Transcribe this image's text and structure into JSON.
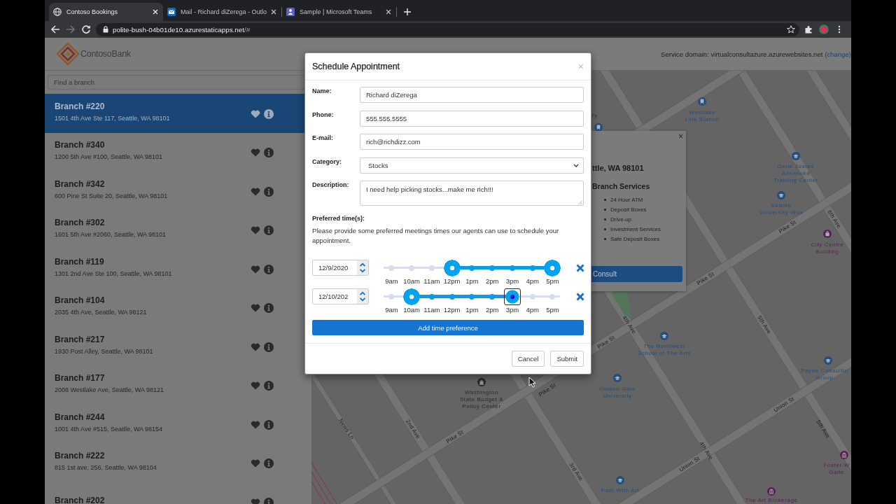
{
  "browser": {
    "tabs": [
      {
        "kind": "globe",
        "title": "Contoso Bookings",
        "selected": true
      },
      {
        "kind": "mail",
        "title": "Mail - Richard diZerega - Outlo",
        "selected": false
      },
      {
        "kind": "teams",
        "title": "Sample | Microsoft Teams",
        "selected": false
      }
    ],
    "nav": [
      {
        "kind": "back",
        "disabled": false
      },
      {
        "kind": "forward",
        "disabled": true
      },
      {
        "kind": "reload",
        "disabled": false
      }
    ],
    "address": {
      "host": "polite-bush-04b01de10.azurestaticapps.net",
      "path": "/#"
    }
  },
  "header": {
    "logo_text": "ContosoBank",
    "service_domain": "Service domain: virtualconsultazure.azurewebsites.net",
    "change_link": "(change)"
  },
  "sidebar": {
    "search": {
      "placeholder": "Find a branch"
    },
    "branches": [
      {
        "name": "Branch #220",
        "address": "1501 4th Ave Ste 117, Seattle, WA 98101",
        "selected": true
      },
      {
        "name": "Branch #340",
        "address": "1200 5th Ave #100, Seattle, WA 98101",
        "selected": false
      },
      {
        "name": "Branch #342",
        "address": "600 Pine St Suite 20, Seattle, WA 98101",
        "selected": false
      },
      {
        "name": "Branch #302",
        "address": "1601 5th Ave #2060, Seattle, WA 98101",
        "selected": false
      },
      {
        "name": "Branch #119",
        "address": "1301 2nd Ave Ste 100, Seattle, WA 98101",
        "selected": false
      },
      {
        "name": "Branch #104",
        "address": "2035 4th Ave, Seattle, WA 98121",
        "selected": false
      },
      {
        "name": "Branch #217",
        "address": "1930 Post Alley, Seattle, WA 98101",
        "selected": false
      },
      {
        "name": "Branch #177",
        "address": "2008 Westlake Ave, Seattle, WA 98121",
        "selected": false
      },
      {
        "name": "Branch #244",
        "address": "1001 4th Ave #515, Seattle, WA 98154",
        "selected": false
      },
      {
        "name": "Branch #222",
        "address": "815 1st ave, 256, Seattle, WA 98104",
        "selected": false
      },
      {
        "name": "Branch #202",
        "selected": false
      }
    ]
  },
  "map": {
    "streets": [
      {
        "name": "Pike St"
      },
      {
        "name": "Pike St"
      },
      {
        "name": "Pike St"
      },
      {
        "name": "Pike St"
      },
      {
        "name": "Pike St"
      },
      {
        "name": "Union St"
      },
      {
        "name": "Union St"
      },
      {
        "name": "6th Ave"
      },
      {
        "name": "5th Ave"
      },
      {
        "name": "5th Ave"
      },
      {
        "name": "4th Ave"
      },
      {
        "name": "4th Ave"
      },
      {
        "name": "3rd Ave"
      },
      {
        "name": "2nd Ave"
      },
      {
        "name": "News Ln"
      }
    ],
    "pois": [
      {
        "kind": "label",
        "lines": [
          "ry"
        ]
      },
      {
        "kind": "transit",
        "color": "#224d7c",
        "lines": [
          "Westlake",
          "Link Station"
        ]
      },
      {
        "kind": "transit",
        "color": "#224d7c"
      },
      {
        "kind": "school",
        "color": "#224d7c",
        "lines": [
          "Gene Juarez",
          "Advanced",
          "Training Center"
        ]
      },
      {
        "kind": "school",
        "color": "#224d7c",
        "lines": [
          "Seattle",
          "University Wsu"
        ]
      },
      {
        "kind": "shop",
        "color": "#5a2150",
        "lines": [
          "City Centre",
          "Building"
        ]
      },
      {
        "kind": "school",
        "color": "#224d7c",
        "lines": [
          "The Northwest",
          "School of The Arts"
        ]
      },
      {
        "kind": "government",
        "color": "#2a2a2a",
        "lines": [
          "Washington",
          "State Budget &",
          "Policy Center"
        ]
      },
      {
        "kind": "school",
        "color": "#224d7c",
        "lines": [
          "Golden Gate",
          "University"
        ]
      },
      {
        "kind": "school",
        "color": "#224d7c",
        "lines": [
          "Payne Consultin",
          "Group"
        ]
      },
      {
        "kind": "museum",
        "color": "#5a2150",
        "lines": [
          "Foster W",
          "Galle"
        ]
      },
      {
        "kind": "school",
        "color": "#224d7c",
        "lines": [
          "Path With Art"
        ]
      },
      {
        "kind": "museum",
        "color": "#5a2150",
        "lines": [
          "The Art Brokerage"
        ]
      }
    ],
    "popup": {
      "close": "×",
      "heading": "ttle, WA 98101",
      "services_title": "Branch Services",
      "services": [
        "24 Hour ATM",
        "Deposit Boxes",
        "Drive-up",
        "Investment Services",
        "Safe Deposit Boxes"
      ],
      "button": "Consult"
    }
  },
  "modal": {
    "title": "Schedule Appointment",
    "close": "×",
    "fields": [
      {
        "label": "Name:",
        "kind": "text",
        "value": "Richard diZerega"
      },
      {
        "label": "Phone:",
        "kind": "text",
        "value": "555.555.5555"
      },
      {
        "label": "E-mail:",
        "kind": "text",
        "value": "rich@richdizz.com"
      },
      {
        "label": "Category:",
        "kind": "select",
        "value": "Stocks"
      },
      {
        "label": "Description:",
        "kind": "textarea",
        "value": "I need help picking stocks...make me rich!!!"
      }
    ],
    "times_title": "Preferred time(s):",
    "times_note": "Please provide some preferred meetings times our agents can use to schedule your appointment.",
    "time_preferences": [
      {
        "date": "12/9/2020",
        "ticks": [
          "9am",
          "10am",
          "11am",
          "12pm",
          "1pm",
          "2pm",
          "3pm",
          "4pm",
          "5pm"
        ],
        "handles": [
          {
            "level": 0.375,
            "focused": false
          },
          {
            "level": 1,
            "focused": false
          }
        ]
      },
      {
        "date": "12/10/202",
        "ticks": [
          "9am",
          "10am",
          "11am",
          "12pm",
          "1pm",
          "2pm",
          "3pm",
          "4pm",
          "5pm"
        ],
        "handles": [
          {
            "level": 0.125,
            "focused": false
          },
          {
            "level": 0.75,
            "focused": true
          }
        ]
      }
    ],
    "add_button": "Add time preference",
    "buttons": [
      "Cancel",
      "Submit"
    ]
  }
}
